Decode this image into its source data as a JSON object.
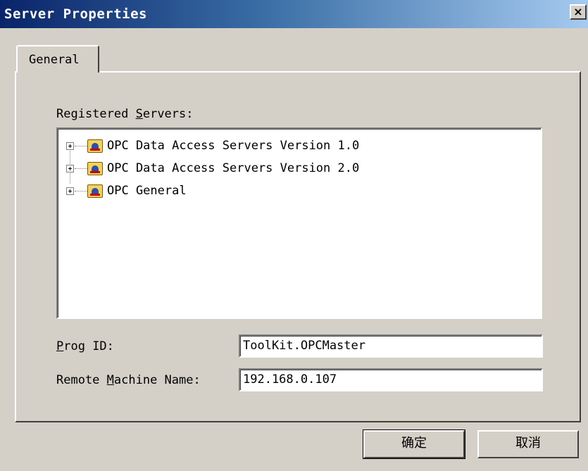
{
  "window": {
    "title": "Server Properties",
    "close_glyph": "×"
  },
  "tabs": [
    {
      "label": "General"
    }
  ],
  "registered_servers": {
    "label_pre": "Registered ",
    "label_accel": "S",
    "label_post": "ervers:",
    "items": [
      {
        "label": "OPC Data Access Servers Version 1.0",
        "icon": "server-folder-icon"
      },
      {
        "label": "OPC Data Access Servers Version 2.0",
        "icon": "server-folder-icon"
      },
      {
        "label": "OPC General",
        "icon": "server-folder-icon"
      }
    ]
  },
  "prog_id": {
    "label_accel": "P",
    "label_post": "rog ID:",
    "value": "ToolKit.OPCMaster"
  },
  "remote_machine": {
    "label_pre": "Remote ",
    "label_accel": "M",
    "label_post": "achine Name:",
    "value": "192.168.0.107"
  },
  "buttons": {
    "ok": "确定",
    "cancel": "取消"
  }
}
